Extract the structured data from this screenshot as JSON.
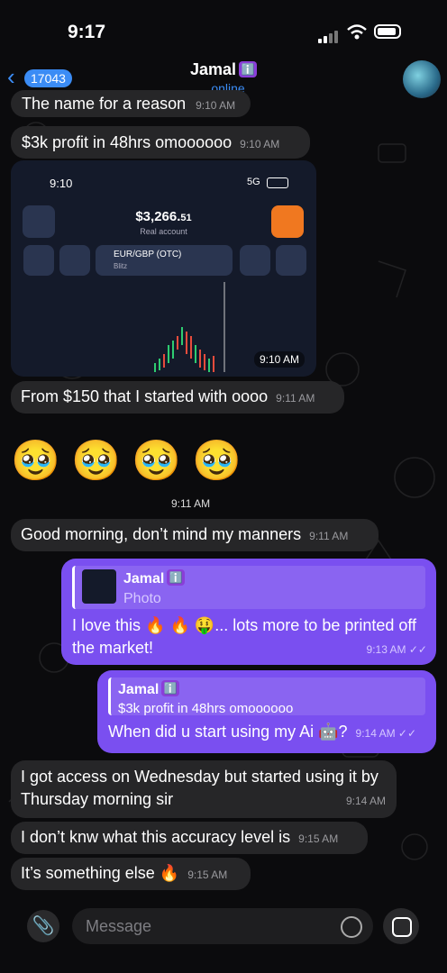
{
  "status": {
    "time": "9:17"
  },
  "header": {
    "back_count": "17043",
    "name": "Jamal",
    "verified": "ℹ️",
    "status": "online"
  },
  "messages": [
    {
      "text": "The name for a reason",
      "time": "9:10 AM"
    },
    {
      "text": "$3k profit in 48hrs omoooooo",
      "time": "9:10 AM"
    },
    {
      "text": "From $150 that I started with oooo",
      "time": "9:11 AM"
    },
    {
      "emoji": "🥹 🥹 🥹 🥹",
      "time": "9:11 AM"
    },
    {
      "text": "Good morning, don’t mind my manners",
      "time": "9:11 AM"
    },
    {
      "reply_name": "Jamal",
      "reply_verified": "ℹ️",
      "reply_text": "Photo",
      "text": "I love this 🔥 🔥 🤑... lots more to be printed off the market!",
      "time": "9:13 AM"
    },
    {
      "reply_name": "Jamal",
      "reply_verified": "ℹ️",
      "reply_text": "$3k profit in 48hrs omoooooo",
      "text": "When did u start using my Ai 🤖?",
      "time": "9:14 AM"
    },
    {
      "text": "I got access on Wednesday but started using it by Thursday morning sir",
      "time": "9:14 AM"
    },
    {
      "text": "I don’t knw what this accuracy level is",
      "time": "9:15 AM"
    },
    {
      "text": "It’s something else 🔥",
      "time": "9:15 AM"
    }
  ],
  "shot": {
    "time": "9:10",
    "net": "5G",
    "amount": "$3,266.",
    "amount_cents": "51",
    "account": "Real account",
    "pair": "EUR/GBP (OTC)",
    "mode": "Blitz",
    "stamp": "9:10 AM"
  },
  "input": {
    "placeholder": "Message"
  },
  "colors": {
    "accent": "#3b8cf5",
    "outgoing": "#7a4ff0"
  }
}
